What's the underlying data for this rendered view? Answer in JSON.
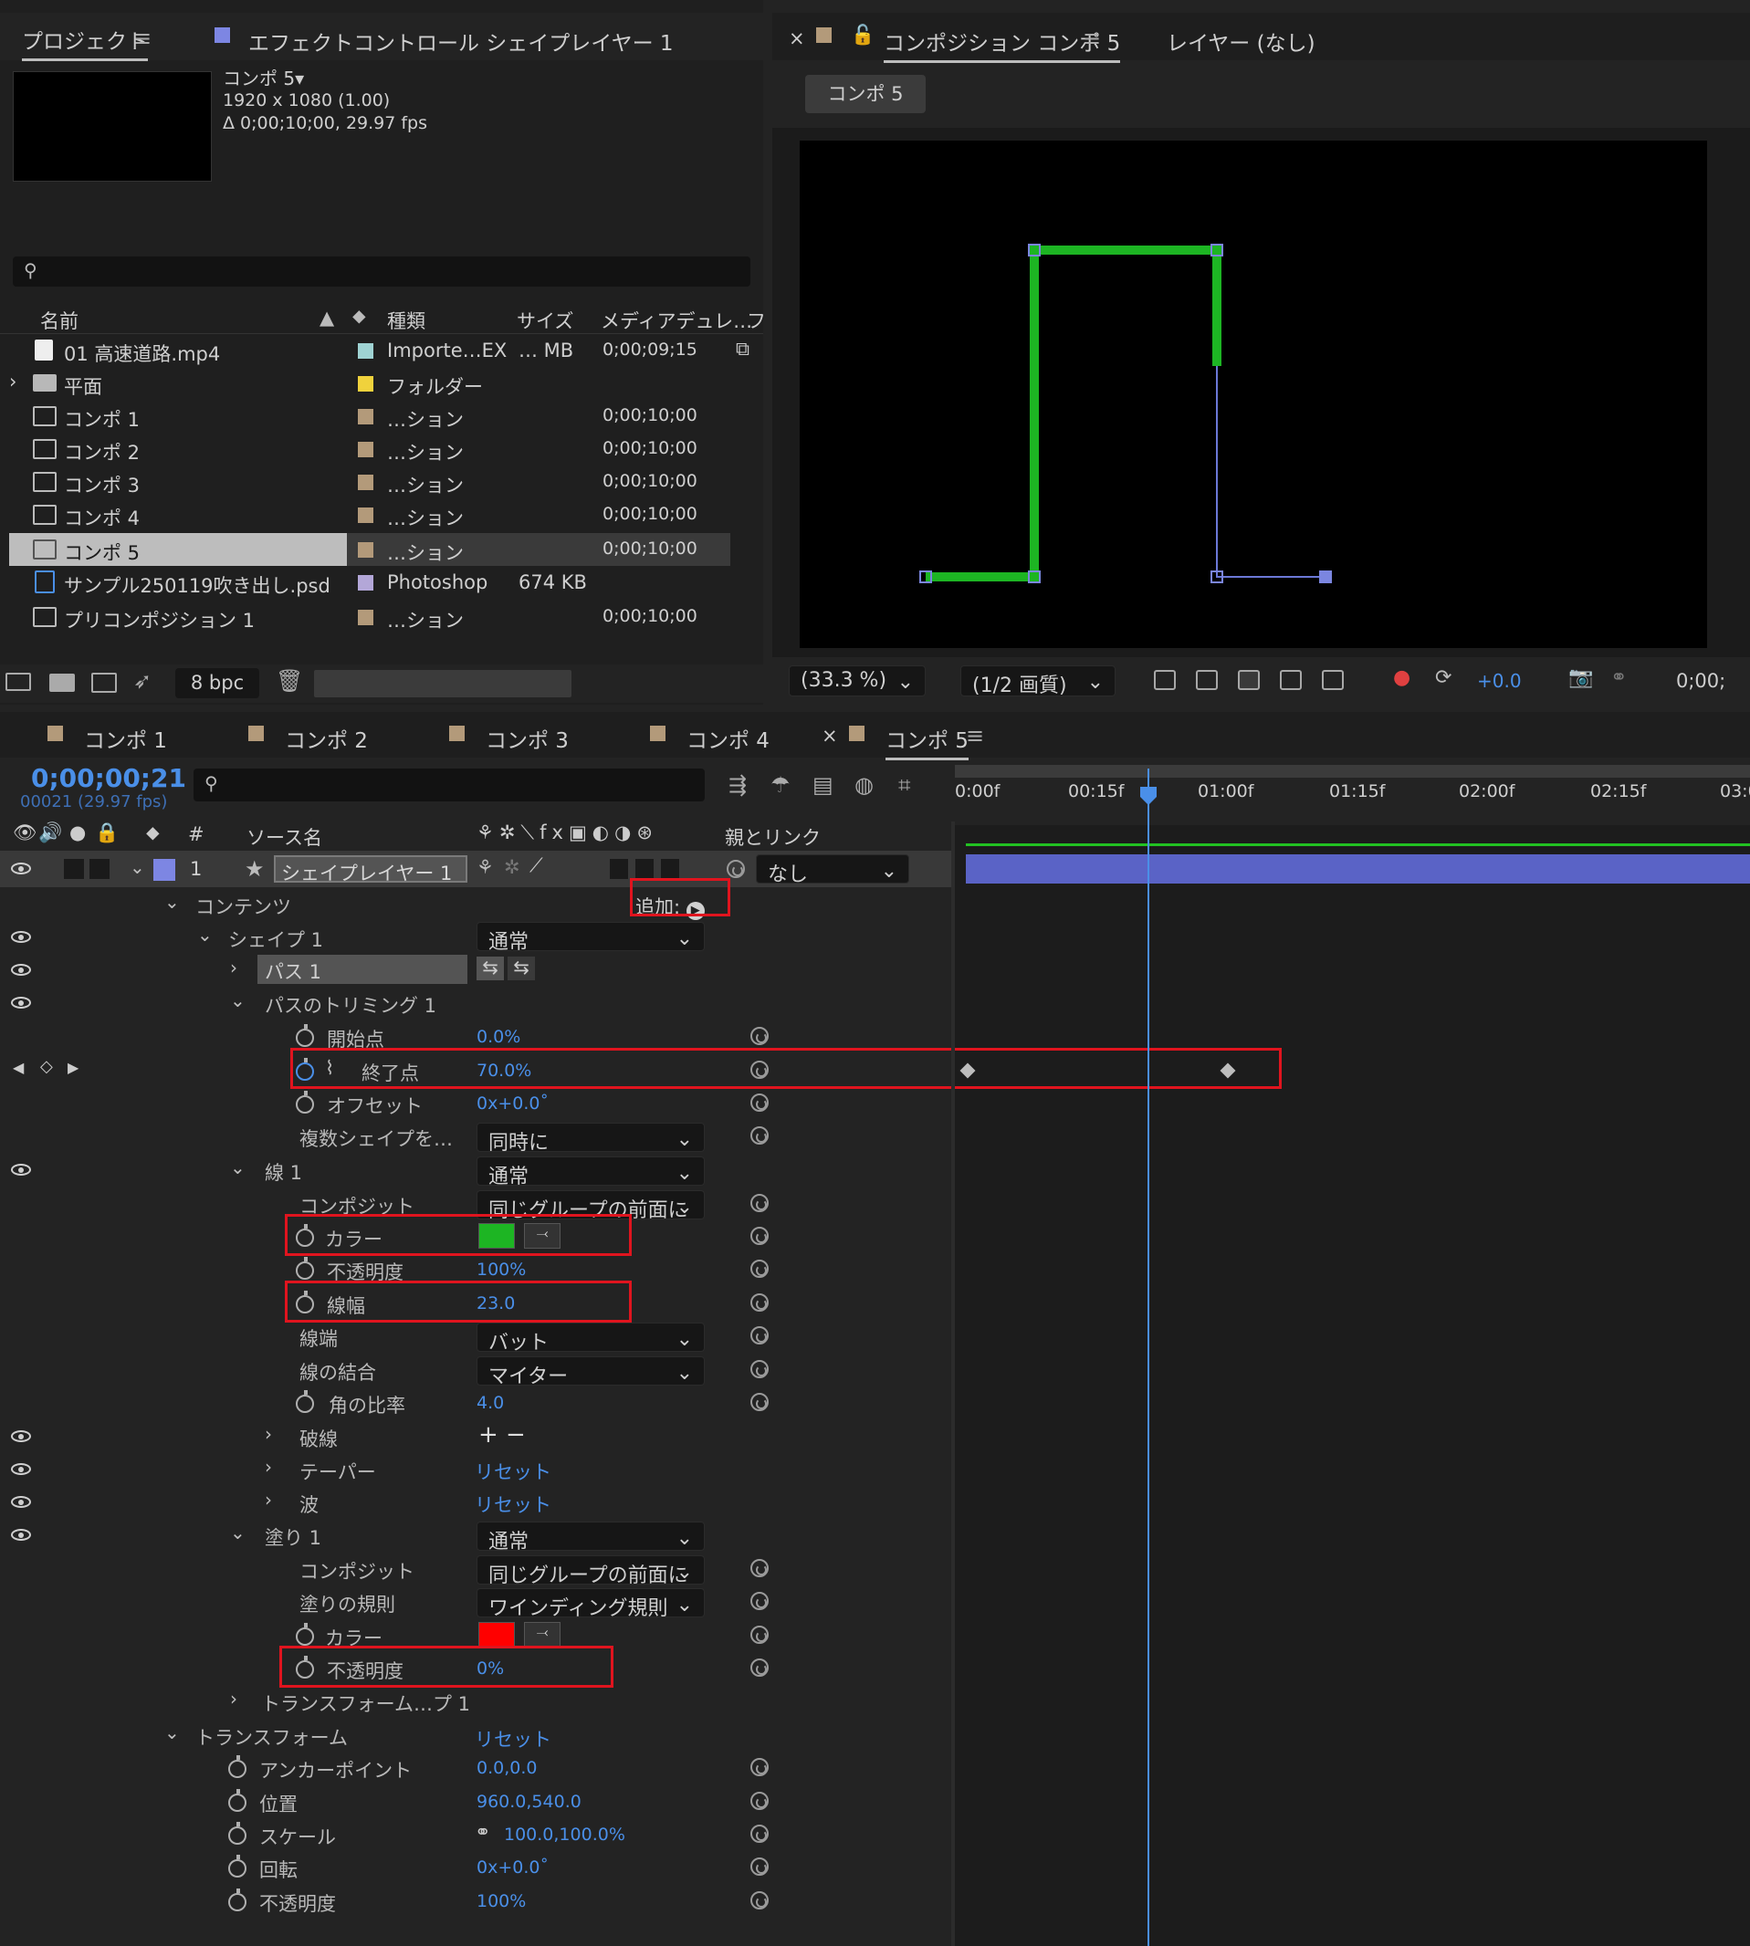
{
  "project": {
    "tab": "プロジェクト",
    "effect_tab": "エフェクトコントロール シェイプレイヤー 1",
    "comp_name": "コンポ 5▾",
    "comp_res": "1920 x 1080 (1.00)",
    "comp_dur": "Δ 0;00;10;00, 29.97 fps",
    "columns": {
      "name": "名前",
      "type": "種類",
      "size": "サイズ",
      "media": "メディアデュレ…",
      "f": "フ"
    },
    "items": [
      {
        "name": "01 高速道路.mp4",
        "type": "Importe…EX",
        "size": "… MB",
        "dur": "0;00;09;15",
        "color": "#9fd3d3"
      },
      {
        "name": "平面",
        "type": "フォルダー",
        "size": "",
        "dur": "",
        "color": "#f0d23c"
      },
      {
        "name": "コンポ 1",
        "type": "…ション",
        "size": "",
        "dur": "0;00;10;00",
        "color": "#b39a7a"
      },
      {
        "name": "コンポ 2",
        "type": "…ション",
        "size": "",
        "dur": "0;00;10;00",
        "color": "#b39a7a"
      },
      {
        "name": "コンポ 3",
        "type": "…ション",
        "size": "",
        "dur": "0;00;10;00",
        "color": "#b39a7a"
      },
      {
        "name": "コンポ 4",
        "type": "…ション",
        "size": "",
        "dur": "0;00;10;00",
        "color": "#b39a7a"
      },
      {
        "name": "コンポ 5",
        "type": "…ション",
        "size": "",
        "dur": "0;00;10;00",
        "color": "#b39a7a"
      },
      {
        "name": "サンプル250119吹き出し.psd",
        "type": "Photoshop",
        "size": "674 KB",
        "dur": "",
        "color": "#b3a7d8"
      },
      {
        "name": "プリコンポジション 1",
        "type": "…ション",
        "size": "",
        "dur": "0;00;10;00",
        "color": "#b39a7a"
      }
    ],
    "bpc": "8 bpc"
  },
  "composition": {
    "tab": "コンポジション コンポ 5",
    "layer_tab": "レイヤー (なし)",
    "chip": "コンポ 5",
    "zoom": "(33.3 %)",
    "quality": "(1/2 画質)",
    "exposure": "+0.0",
    "timecode": "0;00;"
  },
  "timeline": {
    "tabs": [
      "コンポ 1",
      "コンポ 2",
      "コンポ 3",
      "コンポ 4",
      "コンポ 5"
    ],
    "current_time": "0;00;00;21",
    "frame_info": "00021 (29.97 fps)",
    "col_source": "ソース名",
    "col_parent": "親とリンク",
    "layer_num": "1",
    "layer_name": "シェイプレイヤー 1",
    "parent": "なし",
    "ruler": [
      "0:00f",
      "00:15f",
      "01:00f",
      "01:15f",
      "02:00f",
      "02:15f",
      "03:0"
    ],
    "props": {
      "contents": "コンテンツ",
      "add": "追加:",
      "shape1": "シェイプ 1",
      "shape1_mode": "通常",
      "path1": "パス 1",
      "trim": "パスのトリミング 1",
      "start": "開始点",
      "start_v": "0.0%",
      "end": "終了点",
      "end_v": "70.0%",
      "offset": "オフセット",
      "offset_v": "0x+0.0˚",
      "multi": "複数シェイプを…",
      "multi_v": "同時に",
      "stroke1": "線 1",
      "stroke_mode": "通常",
      "composite": "コンポジット",
      "composite_v": "同じグループの前面に",
      "color": "カラー",
      "opacity": "不透明度",
      "opacity_v": "100%",
      "width": "線幅",
      "width_v": "23.0",
      "cap": "線端",
      "cap_v": "バット",
      "join": "線の結合",
      "join_v": "マイター",
      "miter": "角の比率",
      "miter_v": "4.0",
      "dash": "破線",
      "taper": "テーパー",
      "taper_v": "リセット",
      "wave": "波",
      "wave_v": "リセット",
      "fill1": "塗り 1",
      "fill_mode": "通常",
      "fill_composite": "コンポジット",
      "fill_composite_v": "同じグループの前面に",
      "fill_rule": "塗りの規則",
      "fill_rule_v": "ワインディング規則",
      "fill_color": "カラー",
      "fill_opacity": "不透明度",
      "fill_opacity_v": "0%",
      "shape_transform": "トランスフォーム…プ 1",
      "transform": "トランスフォーム",
      "transform_v": "リセット",
      "anchor": "アンカーポイント",
      "anchor_v": "0.0,0.0",
      "position": "位置",
      "position_v": "960.0,540.0",
      "scale": "スケール",
      "scale_v": "100.0,100.0%",
      "rotation": "回転",
      "rotation_v": "0x+0.0˚",
      "t_opacity": "不透明度",
      "t_opacity_v": "100%"
    }
  },
  "colors": {
    "stroke": "#1db523",
    "fill": "#ff0000",
    "accent": "#4a8fe8",
    "label": "#7d86e3",
    "highlight": "#e0141e"
  }
}
